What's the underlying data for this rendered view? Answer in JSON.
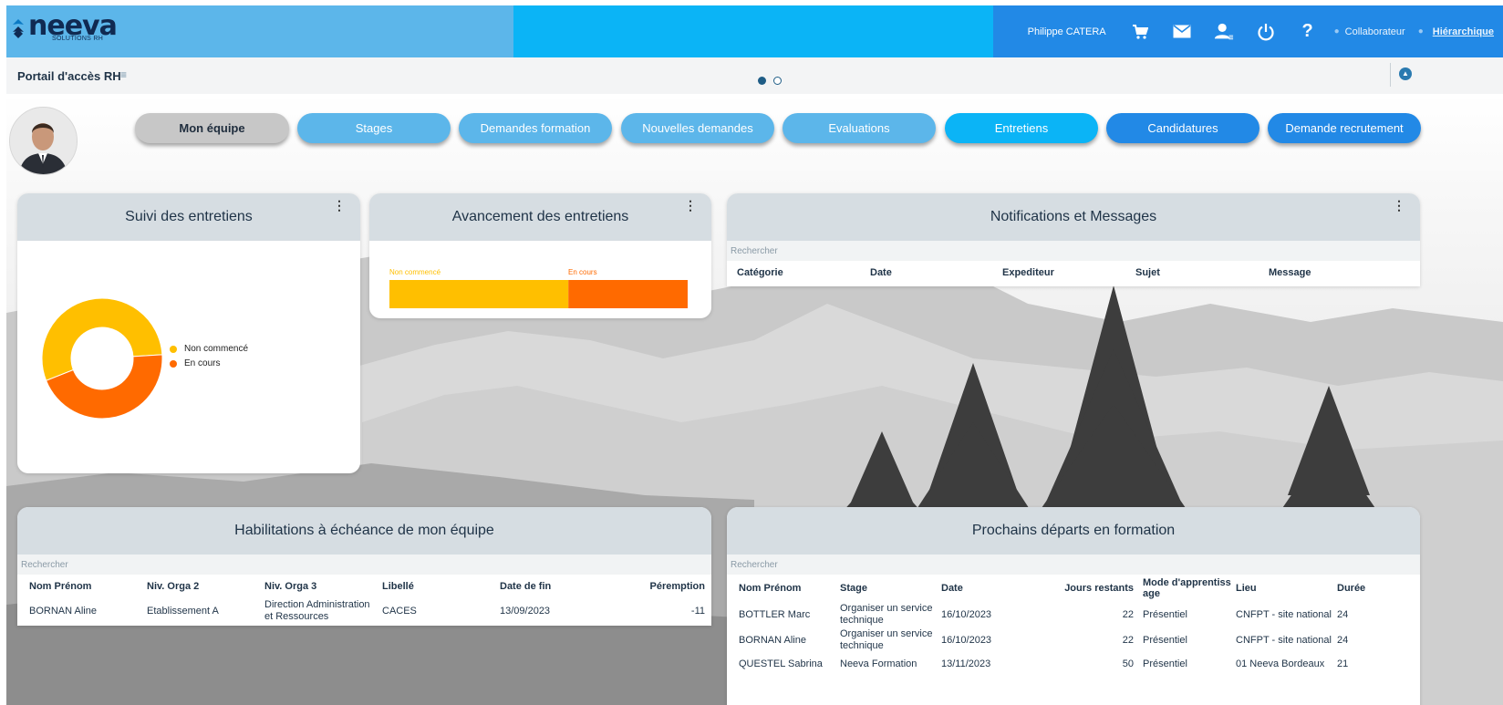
{
  "app": {
    "logo_text": "neeva",
    "logo_sub": "SOLUTIONS RH",
    "user_name": "Philippe CATERA",
    "role_collab": "Collaborateur",
    "role_hier": "Hiérarchique"
  },
  "subbar": {
    "title": "Portail d'accès RH"
  },
  "tabs": [
    {
      "label": "Mon équipe",
      "active": true,
      "color": "#c7c7c7"
    },
    {
      "label": "Stages",
      "color": "#5cb6ea"
    },
    {
      "label": "Demandes  formation",
      "color": "#5cb6ea"
    },
    {
      "label": "Nouvelles demandes",
      "color": "#5cb6ea"
    },
    {
      "label": "Evaluations",
      "color": "#5cb6ea"
    },
    {
      "label": "Entretiens",
      "color": "#0bb4f6"
    },
    {
      "label": "Candidatures",
      "color": "#2289e6"
    },
    {
      "label": "Demande  recrutement",
      "color": "#2289e6"
    }
  ],
  "suivi": {
    "title": "Suivi des entretiens",
    "legend": [
      "Non commencé",
      "En cours"
    ]
  },
  "avancement": {
    "title": "Avancement des entretiens",
    "labels": [
      "Non commencé",
      "En cours"
    ]
  },
  "chart_data": [
    {
      "type": "pie",
      "title": "Suivi des entretiens",
      "categories": [
        "Non commencé",
        "En cours"
      ],
      "values": [
        55,
        45
      ],
      "colors": [
        "#ffbf00",
        "#ff6a00"
      ],
      "legend": "right"
    },
    {
      "type": "bar",
      "title": "Avancement des entretiens",
      "categories": [
        "Non commencé",
        "En cours"
      ],
      "values": [
        60,
        40
      ],
      "stacked": true,
      "colors": [
        "#ffbf00",
        "#ff6a00"
      ],
      "legend": "top"
    }
  ],
  "notifications": {
    "title": "Notifications et Messages",
    "search_placeholder": "Rechercher",
    "columns": [
      "Catégorie",
      "Date",
      "Expediteur",
      "Sujet",
      "Message"
    ]
  },
  "habilitations": {
    "title": "Habilitations à échéance de mon équipe",
    "search_placeholder": "Rechercher",
    "columns": [
      "Nom Prénom",
      "Niv. Orga 2",
      "Niv. Orga 3",
      "Libellé",
      "Date de fin",
      "Péremption"
    ],
    "rows": [
      {
        "nom": "BORNAN Aline",
        "orga2": "Etablissement A",
        "orga3": "Direction Administration et Ressources",
        "libelle": "CACES",
        "date_fin": "13/09/2023",
        "peremption": "-11"
      }
    ]
  },
  "departs": {
    "title": "Prochains départs en formation",
    "search_placeholder": "Rechercher",
    "columns": [
      "Nom Prénom",
      "Stage",
      "Date",
      "Jours restants",
      "Mode d'apprentissage",
      "Lieu",
      "Durée"
    ],
    "rows": [
      {
        "nom": "BOTTLER Marc",
        "stage": "Organiser un service technique",
        "date": "16/10/2023",
        "jours": "22",
        "mode": "Présentiel",
        "lieu": "CNFPT - site national",
        "duree": "24"
      },
      {
        "nom": "BORNAN Aline",
        "stage": "Organiser un service technique",
        "date": "16/10/2023",
        "jours": "22",
        "mode": "Présentiel",
        "lieu": "CNFPT - site national",
        "duree": "24"
      },
      {
        "nom": "QUESTEL Sabrina",
        "stage": "Neeva Formation",
        "date": "13/11/2023",
        "jours": "50",
        "mode": "Présentiel",
        "lieu": "01 Neeva Bordeaux",
        "duree": "21"
      }
    ]
  }
}
